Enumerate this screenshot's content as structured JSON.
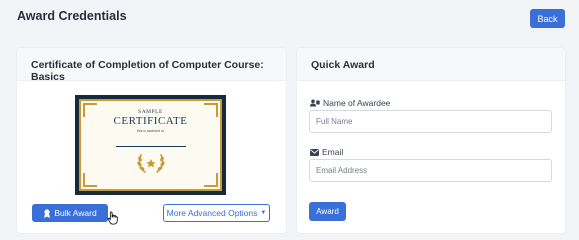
{
  "header": {
    "title": "Award Credentials",
    "back_label": "Back"
  },
  "certificate_card": {
    "title": "Certificate of Completion of Computer Course: Basics",
    "preview": {
      "sample_text": "SAMPLE",
      "certificate_text": "CERTIFICATE",
      "subtitle_text": "this is awarded to"
    },
    "bulk_award_label": "Bulk Award",
    "more_options_label": "More Advanced Options"
  },
  "quick_award": {
    "title": "Quick Award",
    "name_label": "Name of Awardee",
    "name_placeholder": "Full Name",
    "email_label": "Email",
    "email_placeholder": "Email Address",
    "award_label": "Award"
  },
  "colors": {
    "primary": "#3a6fd8",
    "background": "#f3f4f8",
    "certificate_frame": "#152b3c",
    "certificate_gold": "#c79a3a"
  }
}
